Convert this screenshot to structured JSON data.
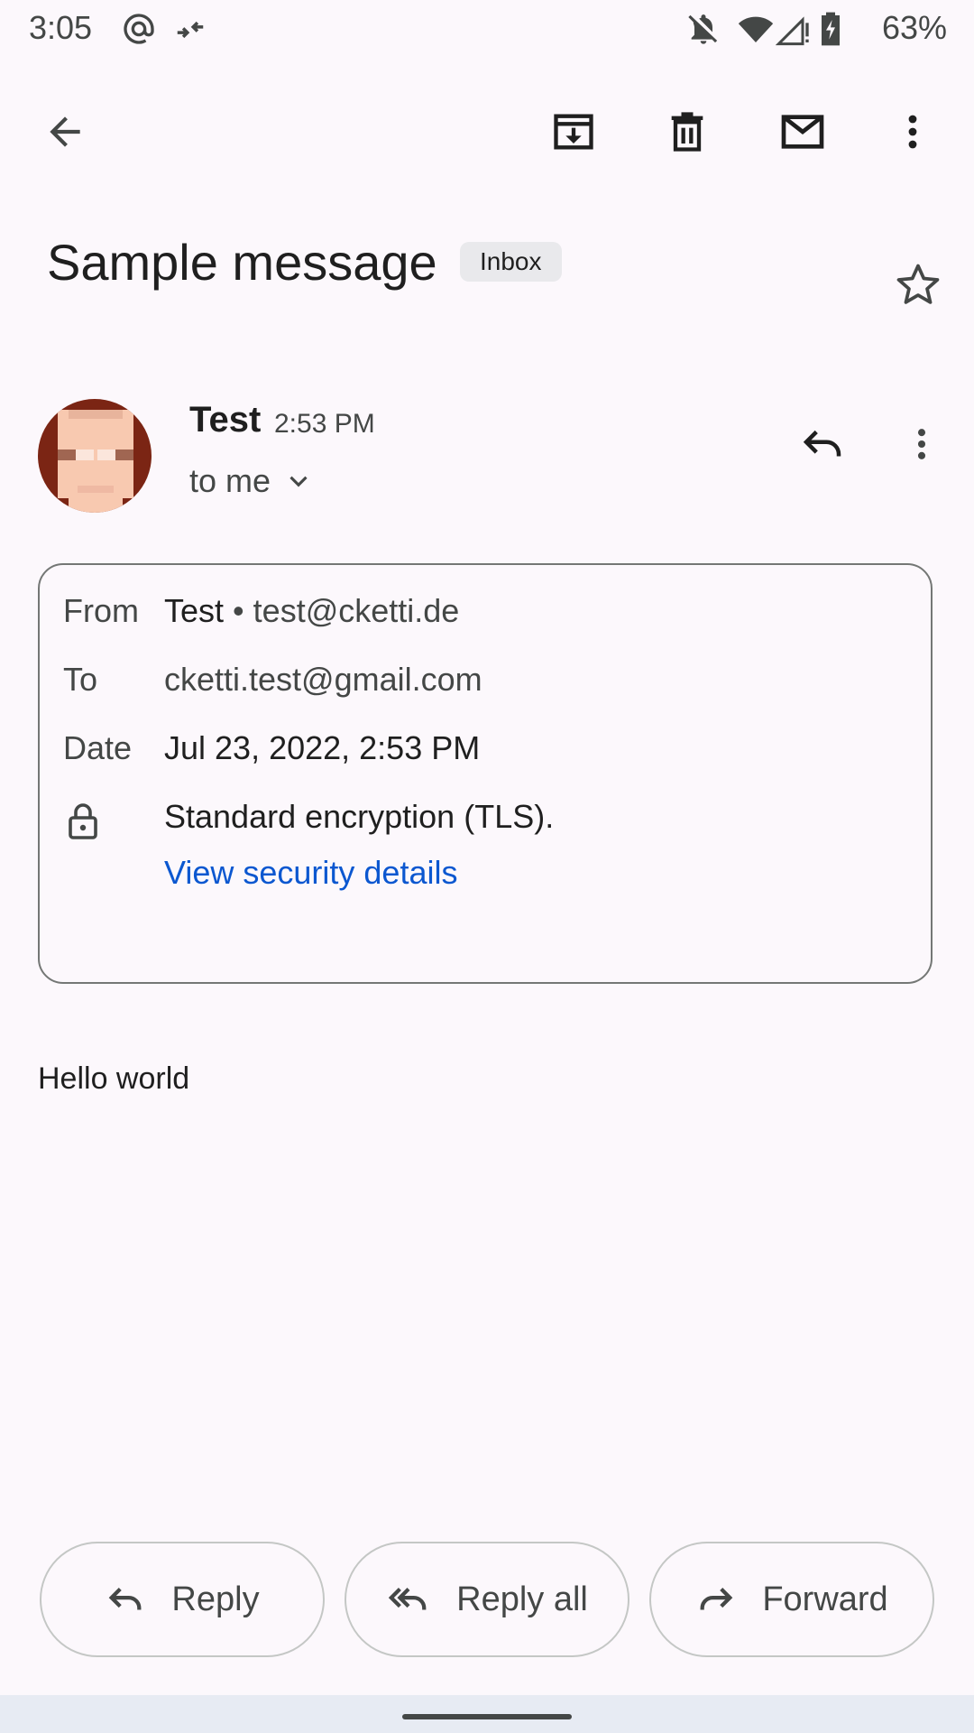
{
  "status_bar": {
    "time": "3:05",
    "battery": "63%",
    "icons": [
      "at-icon",
      "data-saver-icon",
      "notifications-off-icon",
      "wifi-icon",
      "signal-icon",
      "battery-charging-icon"
    ]
  },
  "toolbar": {
    "icons": [
      "back-arrow-icon",
      "archive-icon",
      "delete-icon",
      "mark-unread-icon",
      "more-vert-icon"
    ]
  },
  "message": {
    "subject": "Sample message",
    "label_chip": "Inbox",
    "sender_name": "Test",
    "time": "2:53 PM",
    "recipient_summary": "to me",
    "body": "Hello world"
  },
  "details": {
    "from_label": "From",
    "from_name": "Test",
    "separator": "•",
    "from_email": "test@cketti.de",
    "to_label": "To",
    "to_value": "cketti.test@gmail.com",
    "date_label": "Date",
    "date_value": "Jul 23, 2022, 2:53 PM",
    "encryption": "Standard encryption (TLS).",
    "security_link": "View security details"
  },
  "actions": {
    "reply": "Reply",
    "reply_all": "Reply all",
    "forward": "Forward"
  },
  "colors": {
    "background": "#fcf8fc",
    "link": "#0b57d0",
    "avatar_bg": "#7b2514"
  }
}
